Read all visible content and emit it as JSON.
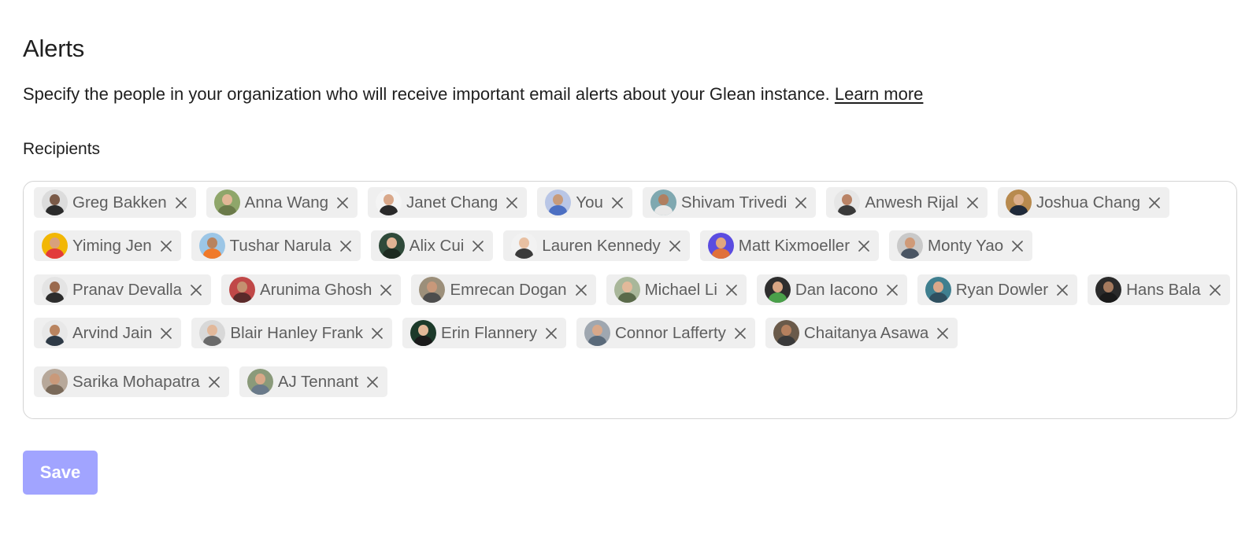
{
  "page": {
    "title": "Alerts",
    "description": "Specify the people in your organization who will receive important email alerts about your Glean instance.",
    "learn_more": "Learn more",
    "recipients_label": "Recipients",
    "save_label": "Save"
  },
  "colors": {
    "accent": "#a1a4ff",
    "chip_bg": "#efefef",
    "chip_text": "#5e5e5e"
  },
  "recipients": [
    {
      "name": "Greg Bakken",
      "bg": "#dcdcdc",
      "skin": "#7a5a48",
      "shirt": "#2b2b2b"
    },
    {
      "name": "Anna Wang",
      "bg": "#8fa66a",
      "skin": "#e2b796",
      "shirt": "#6b7a4a"
    },
    {
      "name": "Janet Chang",
      "bg": "#f4f4f4",
      "skin": "#d9a88a",
      "shirt": "#2a2a2a"
    },
    {
      "name": "You",
      "bg": "#b9c6e6",
      "skin": "#c89b7b",
      "shirt": "#4c6fc2"
    },
    {
      "name": "Shivam Trivedi",
      "bg": "#7fa8b0",
      "skin": "#b07f60",
      "shirt": "#e8e8e8"
    },
    {
      "name": "Anwesh Rijal",
      "bg": "#e6e6e6",
      "skin": "#b98366",
      "shirt": "#3a3a3a"
    },
    {
      "name": "Joshua Chang",
      "bg": "#b88a4e",
      "skin": "#dcae8a",
      "shirt": "#1f2a3a"
    },
    {
      "name": "Yiming Jen",
      "bg": "#f2b705",
      "skin": "#d8a07c",
      "shirt": "#e23b3b"
    },
    {
      "name": "Tushar Narula",
      "bg": "#9cc6e6",
      "skin": "#b8835f",
      "shirt": "#f07a2a"
    },
    {
      "name": "Alix Cui",
      "bg": "#2f4a3a",
      "skin": "#e0b394",
      "shirt": "#1d2a20"
    },
    {
      "name": "Lauren Kennedy",
      "bg": "#f2f2f2",
      "skin": "#e8c0a2",
      "shirt": "#3b3b3b"
    },
    {
      "name": "Matt Kixmoeller",
      "bg": "#5b4ce0",
      "skin": "#e2a67e",
      "shirt": "#e0703a"
    },
    {
      "name": "Monty Yao",
      "bg": "#c9c9c9",
      "skin": "#cf9a78",
      "shirt": "#4a5563"
    },
    {
      "name": "Pranav Devalla",
      "bg": "#e4e4e4",
      "skin": "#9a6a4e",
      "shirt": "#2c2c2c"
    },
    {
      "name": "Arunima Ghosh",
      "bg": "#c04848",
      "skin": "#c49070",
      "shirt": "#5a2a2a"
    },
    {
      "name": "Emrecan Dogan",
      "bg": "#9c8f7a",
      "skin": "#c8987a",
      "shirt": "#4d4d4d"
    },
    {
      "name": "Michael Li",
      "bg": "#a9b79a",
      "skin": "#e2b99a",
      "shirt": "#5a6a4a"
    },
    {
      "name": "Dan Iacono",
      "bg": "#2e2e2e",
      "skin": "#d8a684",
      "shirt": "#4aa04a"
    },
    {
      "name": "Ryan Dowler",
      "bg": "#3f7f8f",
      "skin": "#d9a88a",
      "shirt": "#2f4f5f"
    },
    {
      "name": "Hans Bala",
      "bg": "#2a2a2a",
      "skin": "#a57a5e",
      "shirt": "#1a1a1a"
    },
    {
      "name": "Arvind Jain",
      "bg": "#e8e8e8",
      "skin": "#b98460",
      "shirt": "#2e3a46"
    },
    {
      "name": "Blair Hanley Frank",
      "bg": "#d8d8d8",
      "skin": "#e2b89a",
      "shirt": "#6a6a6a"
    },
    {
      "name": "Erin Flannery",
      "bg": "#1c3a2a",
      "skin": "#e2b898",
      "shirt": "#1a1a1a"
    },
    {
      "name": "Connor Lafferty",
      "bg": "#9fa7b0",
      "skin": "#d8a88a",
      "shirt": "#5a6a7a"
    },
    {
      "name": "Chaitanya Asawa",
      "bg": "#6a5a4a",
      "skin": "#b5805e",
      "shirt": "#3a3a3a"
    },
    {
      "name": "Sarika Mohapatra",
      "bg": "#b7a89a",
      "skin": "#c9997a",
      "shirt": "#7a6a5a"
    },
    {
      "name": "AJ Tennant",
      "bg": "#8a9a7a",
      "skin": "#d8a888",
      "shirt": "#6a7a8a"
    }
  ]
}
